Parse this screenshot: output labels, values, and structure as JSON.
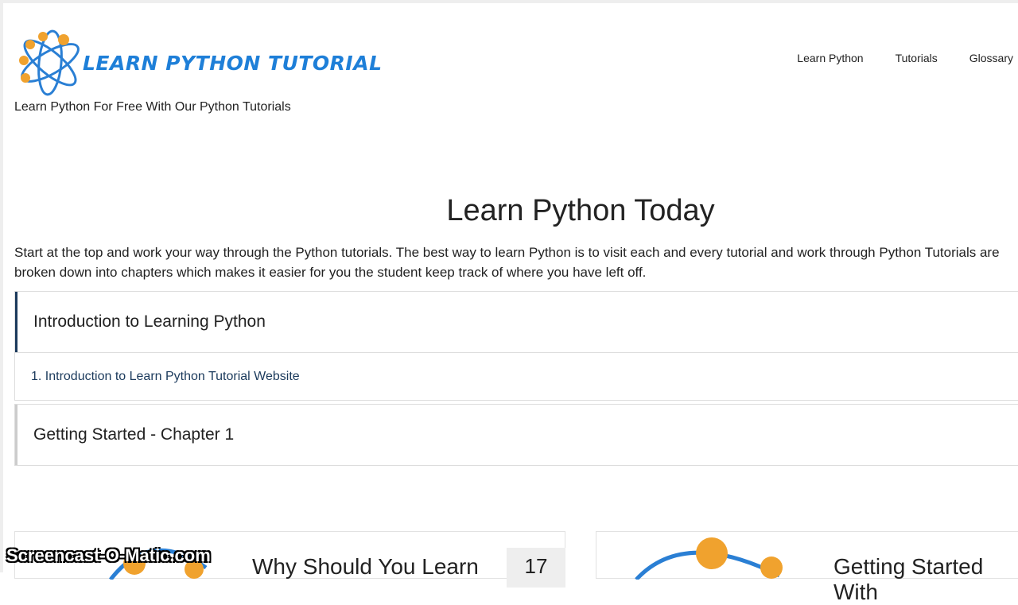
{
  "site": {
    "logo_text": "LEARN PYTHON TUTORIAL",
    "tagline": "Learn Python For Free With Our Python Tutorials"
  },
  "nav": [
    "Learn Python",
    "Tutorials",
    "Glossary"
  ],
  "main": {
    "title": "Learn Python Today",
    "intro_line1": "Start at the top and work your way through the Python tutorials.  The best way to learn Python is to visit each and every tutorial and work through",
    "intro_line2": "Python Tutorials are broken down into chapters which makes it easier for you the student keep track of where you have left off.",
    "sections": [
      {
        "title": "Introduction to Learning Python",
        "items": [
          "1. Introduction to Learn Python Tutorial Website"
        ]
      },
      {
        "title": "Getting Started - Chapter 1"
      }
    ]
  },
  "cards": [
    {
      "title": "Why Should You Learn",
      "count": "17"
    },
    {
      "title": "Getting Started With"
    }
  ],
  "watermark": "Screencast-O-Matic.com"
}
